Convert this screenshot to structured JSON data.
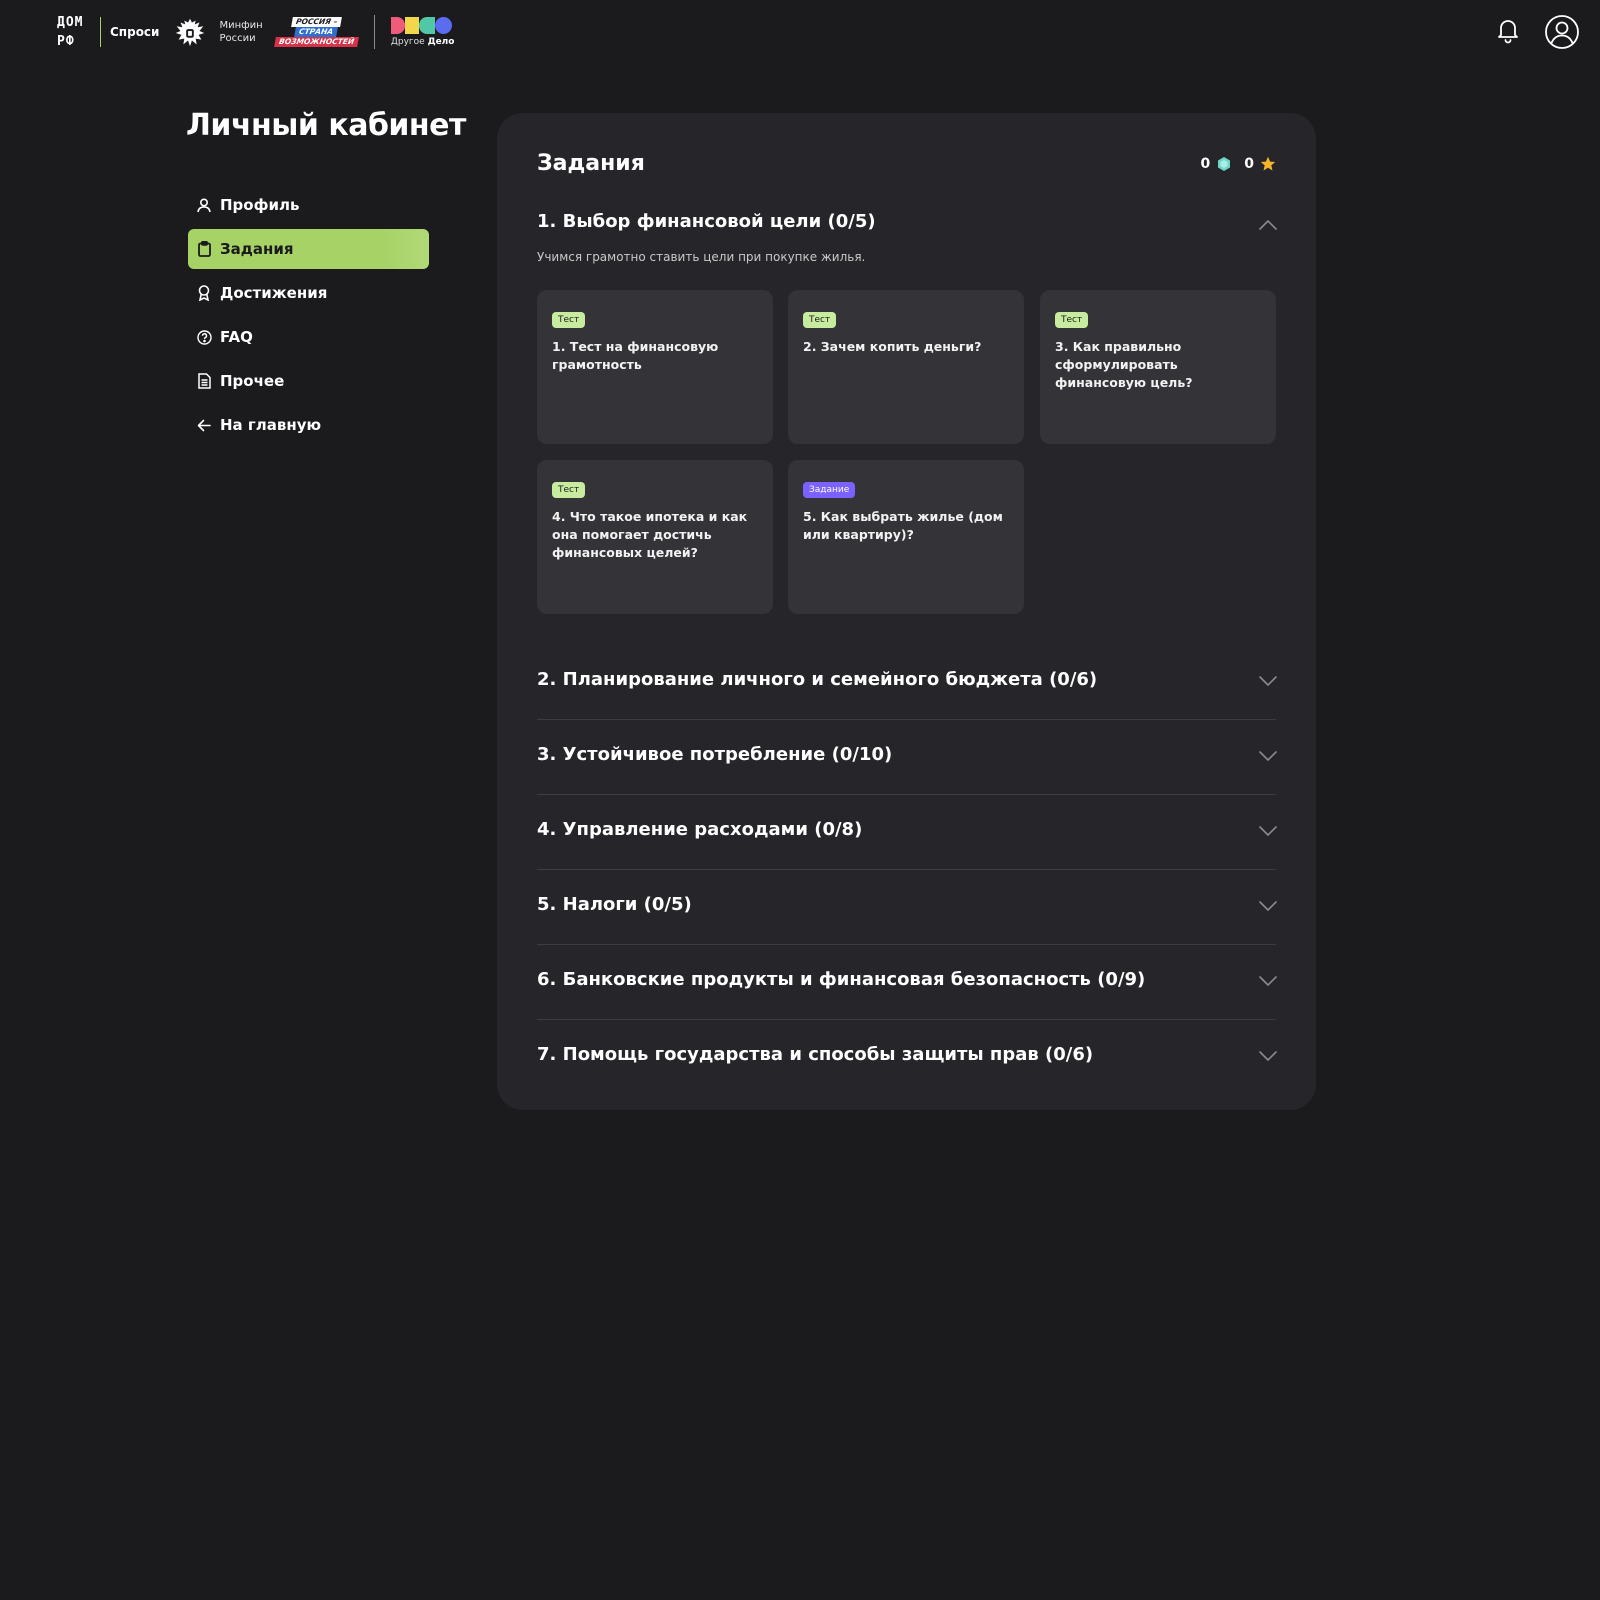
{
  "header": {
    "logo_domrf_top": "ДОМ",
    "logo_domrf_bottom": "РФ",
    "logo_sprosi": "Спроси",
    "logo_minfin": [
      "Минфин",
      "России"
    ],
    "logo_rsv": [
      "РОССИЯ –",
      "СТРАНА",
      "ВОЗМОЖНОСТЕЙ"
    ],
    "logo_dd_prefix": "Другое",
    "logo_dd_bold": "Дело",
    "icons": [
      "bell-icon",
      "user-icon"
    ]
  },
  "sidebar": {
    "title": "Личный кабинет",
    "items": [
      {
        "label": "Профиль",
        "icon": "user-icon",
        "active": false
      },
      {
        "label": "Задания",
        "icon": "clipboard-icon",
        "active": true
      },
      {
        "label": "Достижения",
        "icon": "award-icon",
        "active": false
      },
      {
        "label": "FAQ",
        "icon": "question-icon",
        "active": false
      },
      {
        "label": "Прочее",
        "icon": "document-icon",
        "active": false
      },
      {
        "label": "На главную",
        "icon": "arrow-left-icon",
        "active": false
      }
    ]
  },
  "main": {
    "title": "Задания",
    "scores": {
      "crystals": "0",
      "stars": "0"
    },
    "sections": [
      {
        "title": "1. Выбор финансовой цели (0/5)",
        "expanded": true,
        "description": "Учимся грамотно ставить цели при покупке жилья.",
        "cards": [
          {
            "badge": "Тест",
            "type": "test",
            "title": "1. Тест на финансовую грамотность"
          },
          {
            "badge": "Тест",
            "type": "test",
            "title": "2. Зачем копить деньги?"
          },
          {
            "badge": "Тест",
            "type": "test",
            "title": "3. Как правильно сформулировать финансовую цель?"
          },
          {
            "badge": "Тест",
            "type": "test",
            "title": "4. Что такое ипотека и как она помогает достичь финансовых целей?"
          },
          {
            "badge": "Задание",
            "type": "task",
            "title": "5. Как выбрать жилье (дом или квартиру)?"
          }
        ]
      },
      {
        "title": "2. Планирование личного и семейного бюджета (0/6)",
        "expanded": false
      },
      {
        "title": "3. Устойчивое потребление (0/10)",
        "expanded": false
      },
      {
        "title": "4. Управление расходами (0/8)",
        "expanded": false
      },
      {
        "title": "5. Налоги (0/5)",
        "expanded": false
      },
      {
        "title": "6. Банковские продукты и финансовая безопасность (0/9)",
        "expanded": false
      },
      {
        "title": "7. Помощь государства и способы защиты прав (0/6)",
        "expanded": false
      }
    ]
  },
  "colors": {
    "background": "#1b1a1c",
    "panel": "#262529",
    "card": "#343338",
    "accent_green": "#a6d266",
    "badge_test": "#c7ec9f",
    "badge_task": "#7b61ff",
    "crystal": "#6fd6c8",
    "star": "#f5b52a"
  }
}
